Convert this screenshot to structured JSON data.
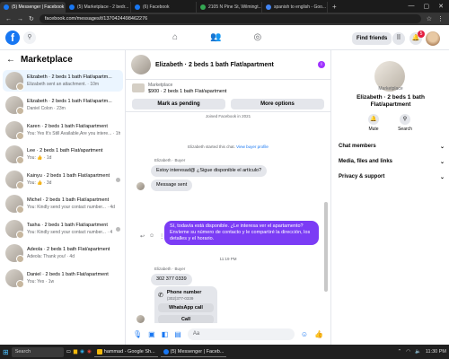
{
  "browser": {
    "tabs": [
      {
        "title": "(5) Messenger | Facebook"
      },
      {
        "title": "(5) Marketplace - 2 bedr..."
      },
      {
        "title": "(6) Facebook"
      },
      {
        "title": "2105 N Pine St, Wilmingt..."
      },
      {
        "title": "spanish to english - Goo..."
      }
    ],
    "url": "facebook.com/messages/t/1370424498462276"
  },
  "topnav": {
    "logo": "f",
    "find_friends": "Find friends",
    "notification_count": "5"
  },
  "marketplace": {
    "title": "Marketplace",
    "conversations": [
      {
        "name": "Elizabeth · 2 beds 1 bath Flat/apartm...",
        "sub": "Elizabeth sent an attachment. · 10m"
      },
      {
        "name": "Elizabeth · 2 beds 1 bath Flat/apartm...",
        "sub": "Daniel Colon · 23m"
      },
      {
        "name": "Karen · 2 beds 1 bath Flat/apartment",
        "sub": "You: Yes It's Still Available,Are you intere... · 1h"
      },
      {
        "name": "Lee · 2 beds 1 bath Flat/apartment",
        "sub": "You: 👍 · 1d"
      },
      {
        "name": "Kainyu · 2 beds 1 bath Flat/apartment",
        "sub": "You: 👍 · 3d"
      },
      {
        "name": "Michel · 2 beds 1 bath Flat/apartment",
        "sub": "You: Kindly send your contact number... · 4d"
      },
      {
        "name": "Tasha · 2 beds 1 bath Flat/apartment",
        "sub": "You: Kindly send your contact number... · 4d"
      },
      {
        "name": "Adeola · 2 beds 1 bath Flat/apartment",
        "sub": "Adeola: Thank you! · 4d"
      },
      {
        "name": "Daniel · 2 beds 1 bath Flat/apartment",
        "sub": "You: Yes · 1w"
      }
    ]
  },
  "chat": {
    "title": "Elizabeth · 2 beds 1 bath Flat/apartment",
    "mp_label": "Marketplace",
    "mp_listing": "$900 · 2 beds 1 bath Flat/apartment",
    "mark_pending": "Mark as pending",
    "more_options": "More options",
    "joined": "Joined Facebook in 2021",
    "started": "Elizabeth started this chat.",
    "view_profile": "View buyer profile",
    "sender1": "Elizabeth · Buyer",
    "msg1": "Estoy interesad@ ¿Sigue disponible el artículo?",
    "msg2": "Message sent",
    "out1": "Sí, todavía está disponible. ¿Le interesa ver el apartamento? Envíeme su número de contacto y le compartiré la dirección, los detalles y el horario.",
    "time": "11:19 PM",
    "sender2": "Elizabeth · Buyer",
    "phone": "302 377 0339",
    "card_title": "Phone number",
    "card_number": "(302)377-0339",
    "whatsapp": "WhatsApp call",
    "call": "Call",
    "composer_placeholder": "Aa"
  },
  "profile": {
    "label": "Marketplace",
    "name": "Elizabeth · 2 beds 1 bath Flat/apartment",
    "mute": "Mute",
    "search": "Search",
    "sections": [
      "Chat members",
      "Media, files and links",
      "Privacy & support"
    ]
  },
  "taskbar": {
    "search": "Search",
    "apps": [
      "hammad - Google Sh...",
      "(5) Messenger | Faceb..."
    ],
    "time": "11:30 PM"
  }
}
